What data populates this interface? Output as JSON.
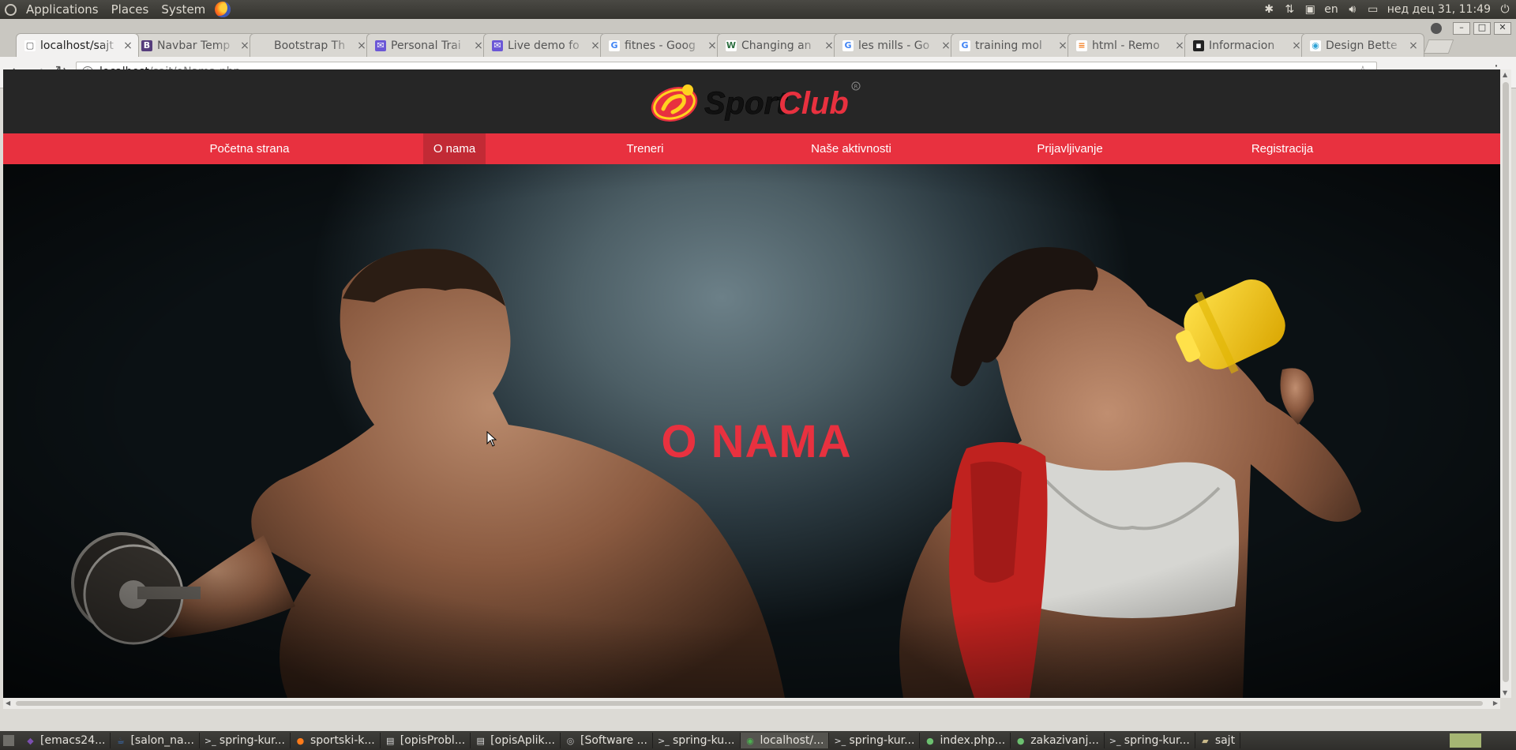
{
  "system_panel": {
    "menus": [
      "Applications",
      "Places",
      "System"
    ],
    "keyboard_layout": "en",
    "clock": "нед дец 31, 11:49"
  },
  "browser": {
    "tabs": [
      {
        "title": "localhost/sajt",
        "icon": "page-icon",
        "active": true
      },
      {
        "title": "Navbar Temp",
        "icon": "bootstrap-icon",
        "active": false
      },
      {
        "title": "Bootstrap Th",
        "icon": "blank-icon",
        "active": false
      },
      {
        "title": "Personal Trai",
        "icon": "mail-icon",
        "active": false
      },
      {
        "title": "Live demo fo",
        "icon": "mail-icon",
        "active": false
      },
      {
        "title": "fitnes - Goog",
        "icon": "google-icon",
        "active": false
      },
      {
        "title": "Changing an",
        "icon": "w3schools-icon",
        "active": false
      },
      {
        "title": "les mills - Go",
        "icon": "google-icon",
        "active": false
      },
      {
        "title": "training mol",
        "icon": "google-icon",
        "active": false
      },
      {
        "title": "html - Remo",
        "icon": "stackoverflow-icon",
        "active": false
      },
      {
        "title": "Informacion",
        "icon": "dark-page-icon",
        "active": false
      },
      {
        "title": "Design Bette",
        "icon": "design-icon",
        "active": false
      }
    ],
    "url_host": "localhost",
    "url_path": "/sajt/oNama.php"
  },
  "site": {
    "logo_text": "SportClub",
    "nav": [
      {
        "label": "Početna strana",
        "active": false
      },
      {
        "label": "O nama",
        "active": true
      },
      {
        "label": "Treneri",
        "active": false
      },
      {
        "label": "Naše aktivnosti",
        "active": false
      },
      {
        "label": "Prijavljivanje",
        "active": false
      },
      {
        "label": "Registracija",
        "active": false
      }
    ],
    "hero_title": "O NAMA",
    "accent_color": "#e8313f",
    "header_color": "#262626"
  },
  "taskbar": {
    "items": [
      {
        "label": "[emacs24...",
        "icon": "emacs-icon"
      },
      {
        "label": "[salon_na...",
        "icon": "java-icon"
      },
      {
        "label": "spring-kur...",
        "icon": "terminal-icon"
      },
      {
        "label": "sportski-k...",
        "icon": "firefox-icon"
      },
      {
        "label": "[opisProbl...",
        "icon": "document-icon"
      },
      {
        "label": "[opisAplik...",
        "icon": "document-icon"
      },
      {
        "label": "[Software ...",
        "icon": "app-icon"
      },
      {
        "label": "spring-ku...",
        "icon": "terminal-icon"
      },
      {
        "label": "localhost/...",
        "icon": "chrome-icon",
        "active": true
      },
      {
        "label": "spring-kur...",
        "icon": "terminal-icon"
      },
      {
        "label": "index.php...",
        "icon": "editor-icon"
      },
      {
        "label": "zakazivanj...",
        "icon": "editor-icon"
      },
      {
        "label": "spring-kur...",
        "icon": "terminal-icon"
      },
      {
        "label": "sajt",
        "icon": "folder-icon"
      }
    ]
  }
}
